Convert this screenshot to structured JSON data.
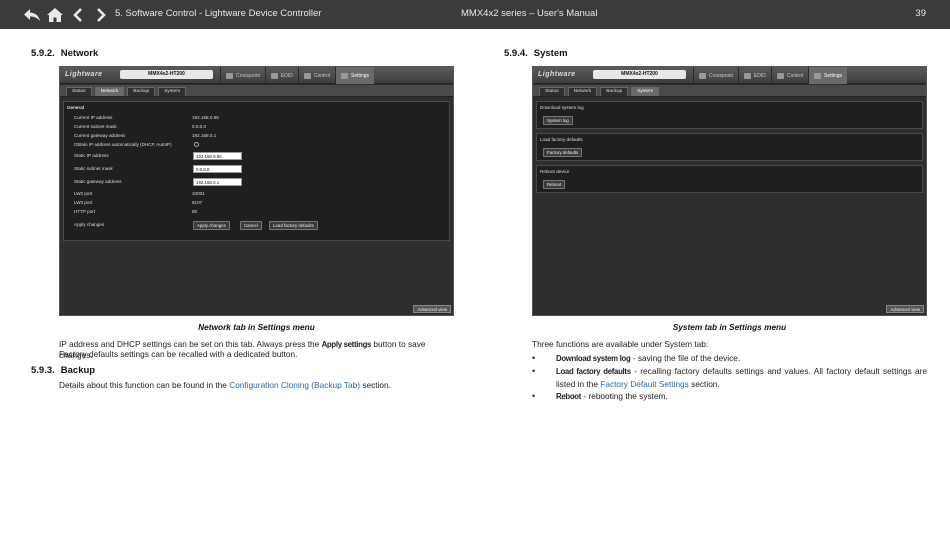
{
  "header": {
    "nav_icons": [
      "back-return-icon",
      "home-icon",
      "chevron-left-icon",
      "chevron-right-icon"
    ],
    "chapter": "5. Software Control - Lightware Device Controller",
    "manual": "MMX4x2 series – User's Manual",
    "page": "39"
  },
  "left": {
    "network_heading_num": "5.9.2.",
    "network_heading": "Network",
    "shot": {
      "logo": "Lightware",
      "device": "MMX4x2-HT200",
      "menus": [
        "Crosspoint",
        "EDID",
        "Control",
        "Settings"
      ],
      "tabs": [
        "Status",
        "Network",
        "Backup",
        "System"
      ],
      "group": "General",
      "rows": [
        {
          "label": "Current IP address",
          "value": "192.168.0.85"
        },
        {
          "label": "Current subnet mask",
          "value": "0.0.0.0"
        },
        {
          "label": "Current gateway address",
          "value": "192.168.0.1"
        },
        {
          "label": "Obtain IP address automatically (DHCP, AutoIP)",
          "value": ""
        },
        {
          "label": "Static IP address",
          "value": "192.168.0.85"
        },
        {
          "label": "Static subnet mask",
          "value": "0.0.0.0"
        },
        {
          "label": "Static gateway address",
          "value": "192.168.0.1"
        },
        {
          "label": "LW2 port",
          "value": "10001"
        },
        {
          "label": "LW3 port",
          "value": "6107"
        },
        {
          "label": "HTTP port",
          "value": "80"
        },
        {
          "label": "Apply changes",
          "value": ""
        }
      ],
      "buttons": [
        "Apply changes",
        "Cancel",
        "Load factory defaults"
      ],
      "advanced": "Advanced view"
    },
    "caption": "Network tab in Settings menu",
    "para1_a": "IP address and DHCP settings can be set on this tab. Always press the ",
    "para1_btn": "Apply settings",
    "para1_b": " button to save changes.",
    "para2": "Factory defaults settings can be recalled with a dedicated button.",
    "backup_heading_num": "5.9.3.",
    "backup_heading": "Backup",
    "backup_a": "Details about this function can be found in the ",
    "backup_link": "Configuration Cloning (Backup Tab)",
    "backup_b": " section."
  },
  "right": {
    "system_heading_num": "5.9.4.",
    "system_heading": "System",
    "shot": {
      "logo": "Lightware",
      "device": "MMX4x2-HT200",
      "menus": [
        "Crosspoint",
        "EDID",
        "Control",
        "Settings"
      ],
      "tabs": [
        "Status",
        "Network",
        "Backup",
        "System"
      ],
      "panels": [
        {
          "title": "Download system log",
          "button": "System log"
        },
        {
          "title": "Load factory defaults",
          "button": "Factory defaults"
        },
        {
          "title": "Reboot device",
          "button": "Reboot"
        }
      ],
      "advanced": "Advanced view"
    },
    "caption": "System tab in Settings menu",
    "intro": "Three functions are available under System tab:",
    "b1_key": "Download system log",
    "b1_text": " - saving the file of the device.",
    "b2_key": "Load factory defaults",
    "b2_text_a": " - recalling factory defaults settings and values. All factory default settings are listed in the ",
    "b2_link": "Factory Default Settings",
    "b2_text_b": " section.",
    "b3_key": "Reboot",
    "b3_text": " - rebooting the system."
  }
}
